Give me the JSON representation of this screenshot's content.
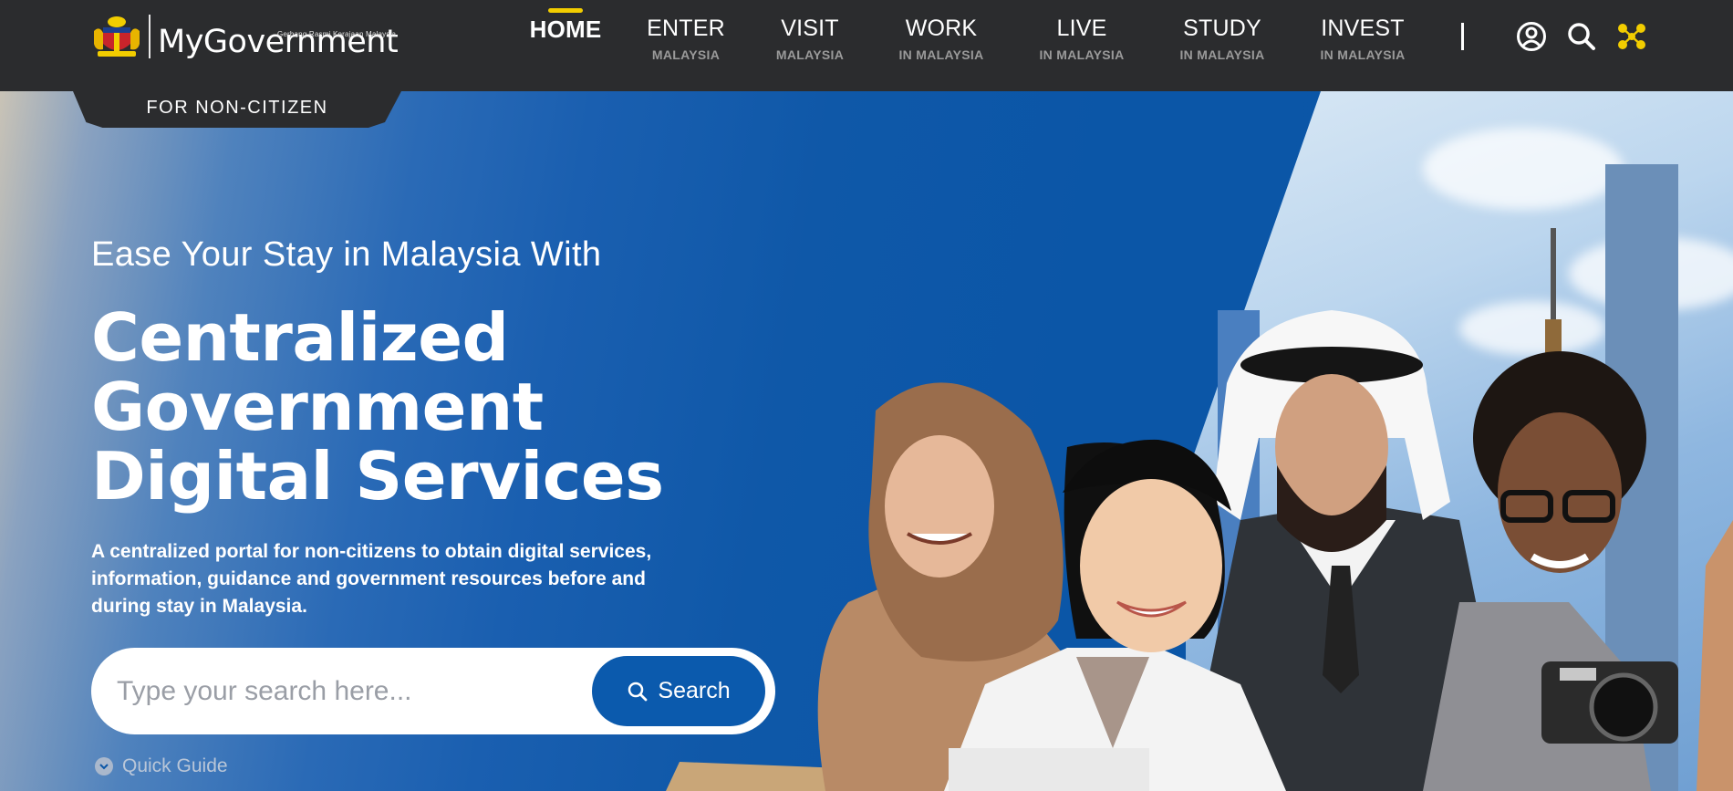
{
  "header": {
    "logo": {
      "text_my": "My",
      "text_gov": "Government",
      "tagline": "Gerbang Rasmi Kerajaan Malaysia"
    },
    "nav": [
      {
        "main": "HOME",
        "sub": "",
        "active": true
      },
      {
        "main": "ENTER",
        "sub": "MALAYSIA",
        "active": false
      },
      {
        "main": "VISIT",
        "sub": "MALAYSIA",
        "active": false
      },
      {
        "main": "WORK",
        "sub": "IN MALAYSIA",
        "active": false
      },
      {
        "main": "LIVE",
        "sub": "IN MALAYSIA",
        "active": false
      },
      {
        "main": "STUDY",
        "sub": "IN MALAYSIA",
        "active": false
      },
      {
        "main": "INVEST",
        "sub": "IN MALAYSIA",
        "active": false
      }
    ],
    "icons": [
      "user-account-icon",
      "search-icon",
      "sitemap-icon"
    ],
    "accent_color": "#F2CD00"
  },
  "audience_tab": "FOR NON-CITIZEN",
  "hero": {
    "eyebrow": "Ease Your Stay in Malaysia With",
    "headline": [
      "Centralized",
      "Government",
      "Digital Services"
    ],
    "description": "A centralized portal for non-citizens to obtain digital services, information, guidance and government resources before and during stay in Malaysia.",
    "search": {
      "placeholder": "Type your search here...",
      "value": "",
      "button_label": "Search"
    },
    "quick_guide": "Quick Guide",
    "primary_color": "#0B5AAD"
  }
}
